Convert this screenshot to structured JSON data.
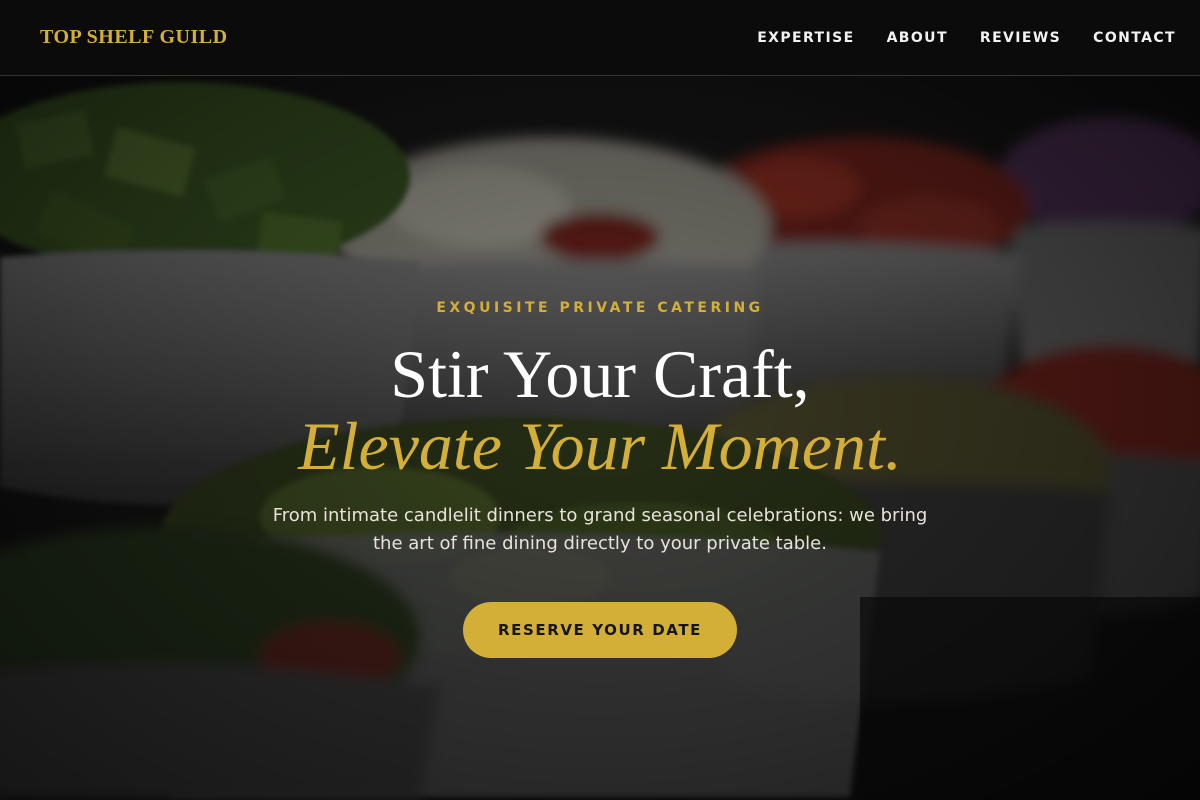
{
  "header": {
    "brand": "TOP SHELF GUILD",
    "nav": [
      {
        "label": "EXPERTISE"
      },
      {
        "label": "ABOUT"
      },
      {
        "label": "REVIEWS"
      },
      {
        "label": "CONTACT"
      }
    ]
  },
  "hero": {
    "eyebrow": "EXQUISITE PRIVATE CATERING",
    "headline_line1": "Stir Your Craft,",
    "headline_line2": "Elevate Your Moment.",
    "tagline": "From intimate candlelit dinners to grand seasonal celebrations: we bring the art of fine dining directly to your private table.",
    "cta_label": "RESERVE YOUR DATE",
    "background_image": "catering-bowls-photo"
  },
  "colors": {
    "accent_gold": "#d4af37",
    "header_bg": "#0b0b0b",
    "text_light": "#f2f2f2"
  }
}
